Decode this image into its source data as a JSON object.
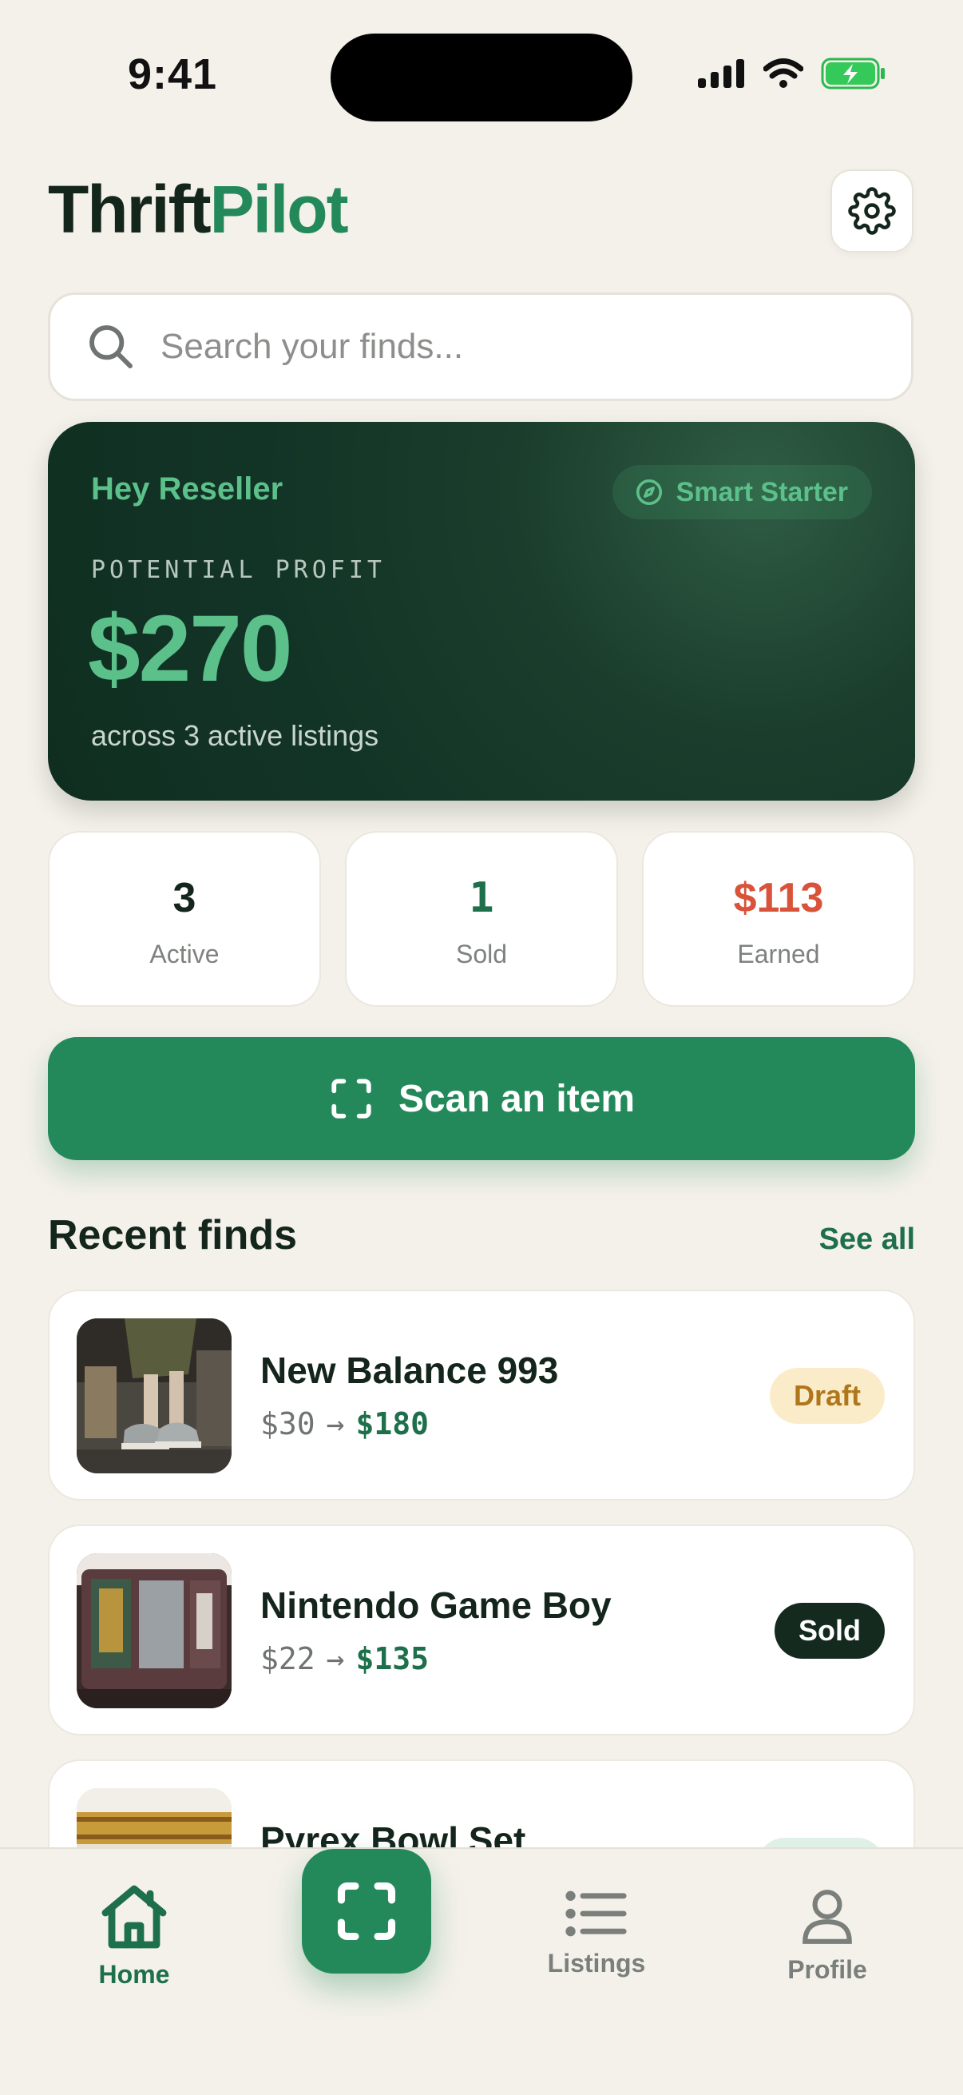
{
  "status_bar": {
    "time": "9:41"
  },
  "header": {
    "title_part1": "Thrift",
    "title_part2": "Pilot",
    "settings_icon": "gear-icon"
  },
  "search": {
    "placeholder": "Search your finds..."
  },
  "hero": {
    "greeting": "Hey Reseller",
    "badge": "Smart Starter",
    "label": "POTENTIAL PROFIT",
    "value": "$270",
    "subtitle": "across 3 active listings"
  },
  "stats": [
    {
      "value": "3",
      "label": "Active",
      "color": "#14251c"
    },
    {
      "value": "1",
      "label": "Sold",
      "color": "#1e6f4b"
    },
    {
      "value": "$113",
      "label": "Earned",
      "color": "#d9533b"
    }
  ],
  "scan_button": {
    "label": "Scan an item"
  },
  "recent": {
    "title": "Recent finds",
    "see_all": "See all",
    "items": [
      {
        "title": "New Balance 993",
        "buy": "$30",
        "sell": "$180",
        "status": "Draft"
      },
      {
        "title": "Nintendo Game Boy",
        "buy": "$22",
        "sell": "$135",
        "status": "Sold"
      },
      {
        "title": "Pyrex Bowl Set",
        "buy": "",
        "sell": "",
        "status": ""
      }
    ]
  },
  "tabs": {
    "home": "Home",
    "listings": "Listings",
    "profile": "Profile"
  },
  "colors": {
    "accent": "#23895a",
    "dark_card": "#123426",
    "background": "#f4f1ea"
  }
}
